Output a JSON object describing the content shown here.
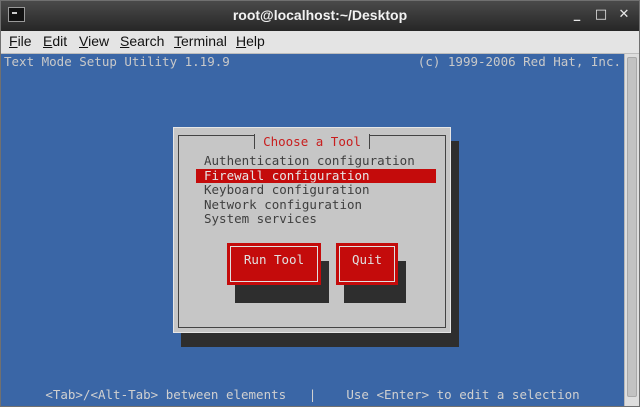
{
  "window": {
    "title": "root@localhost:~/Desktop",
    "minimize_glyph": "_",
    "maximize_glyph": "□",
    "close_glyph": "✕"
  },
  "menubar": {
    "items": [
      {
        "accel": "F",
        "rest": "ile"
      },
      {
        "accel": "E",
        "rest": "dit"
      },
      {
        "accel": "V",
        "rest": "iew"
      },
      {
        "accel": "S",
        "rest": "earch"
      },
      {
        "accel": "T",
        "rest": "erminal"
      },
      {
        "accel": "H",
        "rest": "elp"
      }
    ]
  },
  "terminal": {
    "header_left": "Text Mode Setup Utility 1.19.9",
    "header_right": "(c) 1999-2006 Red Hat, Inc.",
    "status": "<Tab>/<Alt-Tab> between elements   |    Use <Enter> to edit a selection"
  },
  "dialog": {
    "title": "Choose a Tool",
    "items": [
      {
        "label": "Authentication configuration"
      },
      {
        "label": "Firewall configuration",
        "selected": true
      },
      {
        "label": "Keyboard configuration"
      },
      {
        "label": "Network configuration"
      },
      {
        "label": "System services"
      }
    ],
    "run_label": "Run Tool",
    "quit_label": "Quit"
  },
  "colors": {
    "terminal_bg": "#3a66a6",
    "dialog_bg": "#c6c6c6",
    "accent_red": "#c40b0b",
    "title_red": "#c81d1d"
  }
}
